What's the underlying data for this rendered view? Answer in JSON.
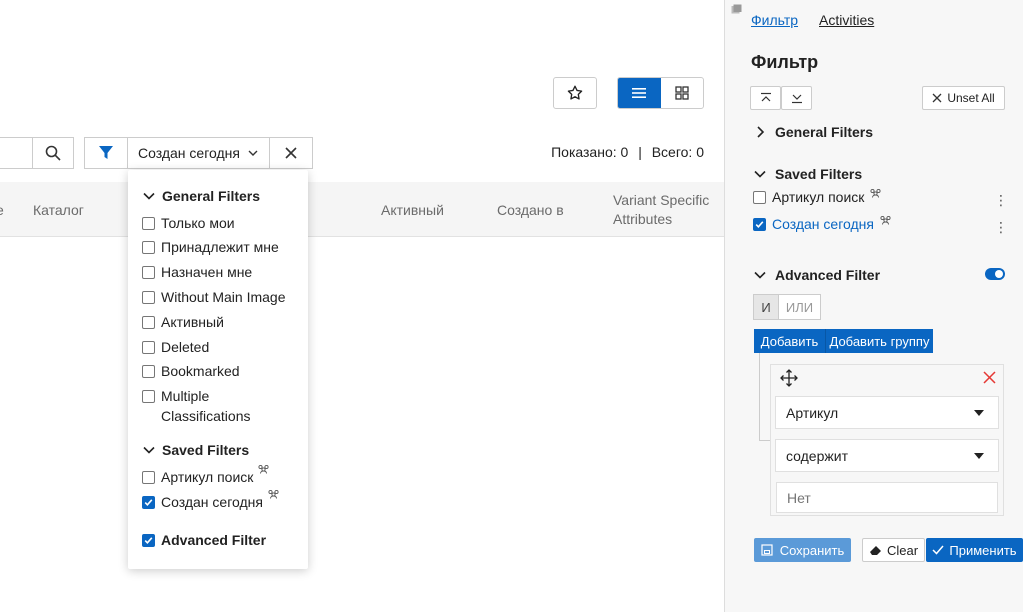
{
  "main": {
    "counts": {
      "shown": "Показано: 0",
      "separator": "|",
      "total": "Всего: 0"
    },
    "saved_filter_selector": "Создан сегодня",
    "table_headers": [
      "e",
      "Каталог",
      "Активный",
      "Создано в",
      "Variant Specific",
      "Attributes"
    ]
  },
  "dropdown": {
    "general_title": "General Filters",
    "general_items": [
      {
        "label": "Только мои",
        "checked": false
      },
      {
        "label": "Принадлежит мне",
        "checked": false
      },
      {
        "label": "Назначен мне",
        "checked": false
      },
      {
        "label": "Without Main Image",
        "checked": false
      },
      {
        "label": "Активный",
        "checked": false
      },
      {
        "label": "Deleted",
        "checked": false
      },
      {
        "label": "Bookmarked",
        "checked": false
      },
      {
        "label": "Multiple",
        "label2": "Classifications",
        "checked": false
      }
    ],
    "saved_title": "Saved Filters",
    "saved_items": [
      {
        "label": "Артикул поиск",
        "checked": false
      },
      {
        "label": "Создан сегодня",
        "checked": true
      }
    ],
    "advanced_label": "Advanced Filter",
    "advanced_checked": true
  },
  "panel": {
    "tabs": [
      "Фильтр",
      "Activities"
    ],
    "title": "Фильтр",
    "unset_all": "Unset All",
    "general_filters": "General Filters",
    "saved_filters": "Saved Filters",
    "saved_items": [
      {
        "label": "Артикул поиск",
        "checked": false
      },
      {
        "label": "Создан сегодня",
        "checked": true
      }
    ],
    "advanced_filter": "Advanced Filter",
    "advanced_enabled": true,
    "and_label": "И",
    "or_label": "ИЛИ",
    "add_label": "Добавить",
    "add_group_label": "Добавить группу",
    "field_value": "Артикул",
    "operator_value": "содержит",
    "value_placeholder": "Нет",
    "save_label": "Сохранить",
    "clear_label": "Clear",
    "apply_label": "Применить"
  },
  "colors": {
    "accent": "#0a66c2",
    "panel_bg": "#f7f7f7",
    "danger": "#e53935"
  }
}
